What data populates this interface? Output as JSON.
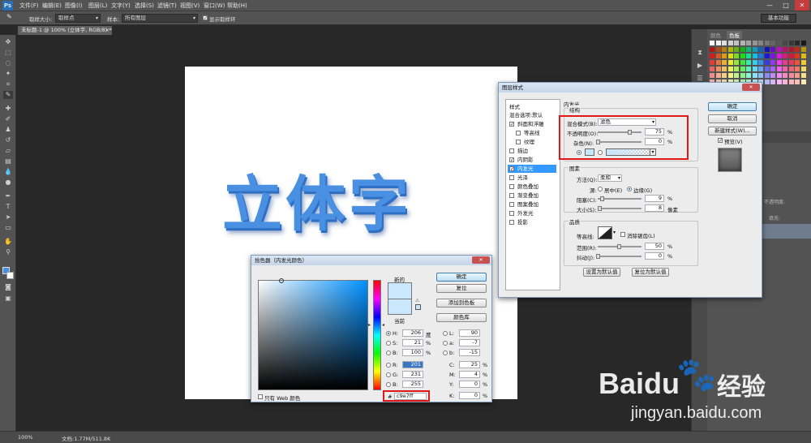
{
  "app": {
    "logo": "Ps",
    "workspace": "基本功能"
  },
  "menubar": [
    "文件(F)",
    "编辑(E)",
    "图像(I)",
    "图层(L)",
    "文字(Y)",
    "选择(S)",
    "滤镜(T)",
    "视图(V)",
    "窗口(W)",
    "帮助(H)"
  ],
  "window_controls": {
    "minimize": "—",
    "maximize": "□",
    "close": "✕"
  },
  "options": {
    "sample_size_label": "取样大小:",
    "sample_size_value": "取样点",
    "sample_label": "样本:",
    "sample_value": "所有图层",
    "show_ring_label": "显示取样环",
    "show_ring_checked": true
  },
  "document": {
    "tab_label": "未标题-1 @ 100% (立体字, RGB/8) *",
    "tab_close": "×",
    "canvas_text": "立体字",
    "text_color": "#4a90e2"
  },
  "statusbar": {
    "zoom": "100%",
    "doc_info": "文档:1.77M/511.8K"
  },
  "right_panel": {
    "tab_swatches_1": "颜色",
    "tab_swatches_2": "色板",
    "opacity_label": "不透明度:",
    "fill_label": "填充:"
  },
  "layer_style": {
    "title": "图层样式",
    "styles_header": "样式",
    "styles": [
      {
        "label": "混合选项:默认",
        "checkbox": false,
        "checked": false
      },
      {
        "label": "斜面和浮雕",
        "checkbox": true,
        "checked": true
      },
      {
        "label": "等高线",
        "checkbox": true,
        "checked": false
      },
      {
        "label": "纹理",
        "checkbox": true,
        "checked": false
      },
      {
        "label": "描边",
        "checkbox": true,
        "checked": false
      },
      {
        "label": "内阴影",
        "checkbox": true,
        "checked": true
      },
      {
        "label": "内发光",
        "checkbox": true,
        "checked": true
      },
      {
        "label": "光泽",
        "checkbox": true,
        "checked": false
      },
      {
        "label": "颜色叠加",
        "checkbox": true,
        "checked": false
      },
      {
        "label": "渐变叠加",
        "checkbox": true,
        "checked": false
      },
      {
        "label": "图案叠加",
        "checkbox": true,
        "checked": false
      },
      {
        "label": "外发光",
        "checkbox": true,
        "checked": false
      },
      {
        "label": "投影",
        "checkbox": true,
        "checked": false
      }
    ],
    "selected_style_index": 6,
    "section_title": "内发光",
    "structure_title": "结构",
    "blend_mode_label": "混合模式(B):",
    "blend_mode_value": "滤色",
    "opacity_label": "不透明度(O):",
    "opacity_value": "75",
    "opacity_level": 0.75,
    "noise_label": "杂色(N):",
    "noise_value": "0",
    "noise_level": 0,
    "percent": "%",
    "elements_title": "图素",
    "method_label": "方法(Q):",
    "method_value": "柔和",
    "source_label": "源:",
    "source_center": "居中(E)",
    "source_edge": "边缘(G)",
    "choke_label": "阻塞(C):",
    "choke_value": "9",
    "choke_level": 0.09,
    "size_label": "大小(S):",
    "size_value": "8",
    "size_unit": "像素",
    "size_level": 0.03,
    "quality_title": "品质",
    "contour_label": "等高线:",
    "antialias_label": "消除锯齿(L)",
    "range_label": "范围(R):",
    "range_value": "50",
    "range_level": 0.5,
    "jitter_label": "抖动(J):",
    "jitter_value": "0",
    "jitter_level": 0,
    "make_default": "设置为默认值",
    "reset_default": "复位为默认值",
    "ok": "确定",
    "cancel": "取消",
    "new_style": "新建样式(W)...",
    "preview_label": "预览(V)",
    "glow_color": "#c9e7ff"
  },
  "color_picker": {
    "title": "拾色器（内发光颜色）",
    "new_label": "新的",
    "current_label": "当前",
    "ok": "确定",
    "cancel": "复位",
    "add_swatch": "添加到色板",
    "color_library": "颜色库",
    "web_only_label": "只有 Web 颜色",
    "H": {
      "label": "H:",
      "value": "206",
      "unit": "度"
    },
    "S": {
      "label": "S:",
      "value": "21",
      "unit": "%"
    },
    "B": {
      "label": "B:",
      "value": "100",
      "unit": "%"
    },
    "R": {
      "label": "R:",
      "value": "201"
    },
    "G": {
      "label": "G:",
      "value": "231"
    },
    "Bl": {
      "label": "B:",
      "value": "255"
    },
    "L": {
      "label": "L:",
      "value": "90"
    },
    "a": {
      "label": "a:",
      "value": "-7"
    },
    "b": {
      "label": "b:",
      "value": "-15"
    },
    "C": {
      "label": "C:",
      "value": "25",
      "unit": "%"
    },
    "M": {
      "label": "M:",
      "value": "4",
      "unit": "%"
    },
    "Y": {
      "label": "Y:",
      "value": "0",
      "unit": "%"
    },
    "K": {
      "label": "K:",
      "value": "0",
      "unit": "%"
    },
    "hex_label": "#",
    "hex_value": "c9e7ff",
    "new_color": "#c9e7ff",
    "current_color": "#c9e7ff"
  },
  "watermark": {
    "brand": "Baidu",
    "brand_cn": "经验",
    "url": "jingyan.baidu.com"
  }
}
